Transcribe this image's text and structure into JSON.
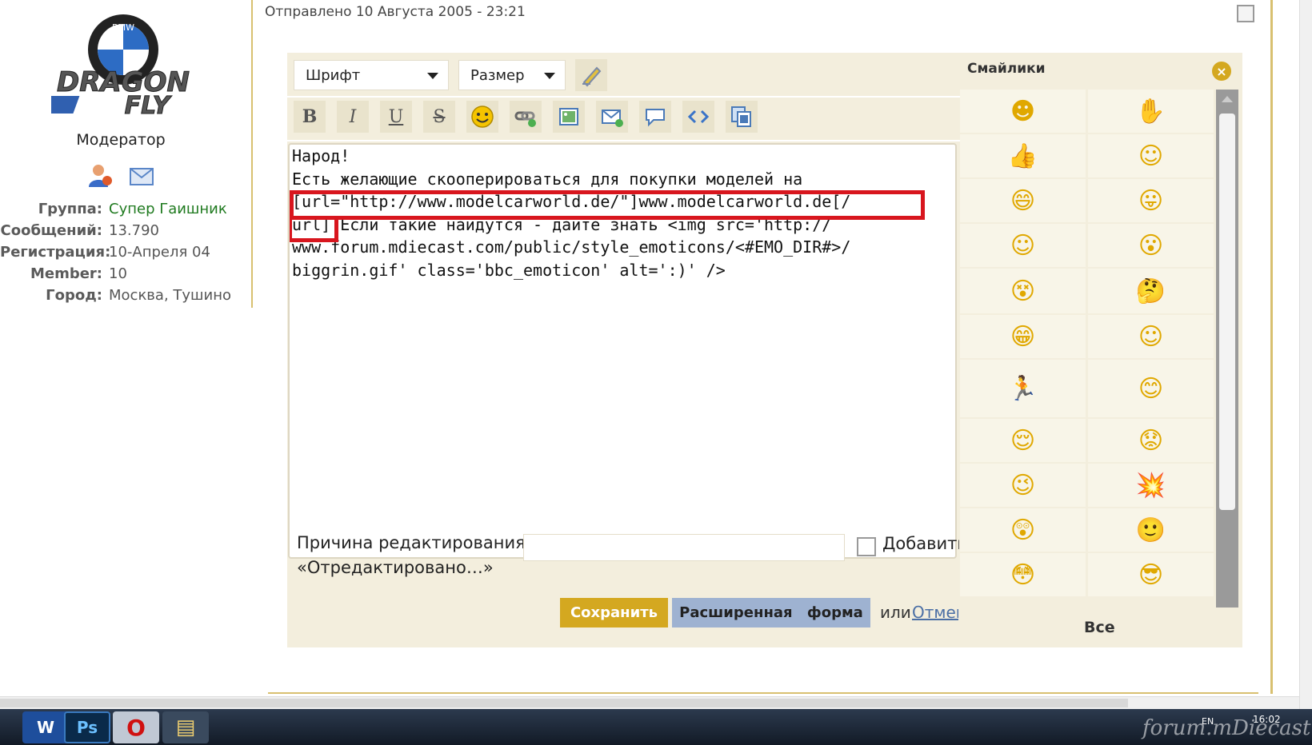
{
  "profile": {
    "logo_text_top": "DRAGON",
    "logo_text_bottom": "FLY",
    "logo_badge": "BMW",
    "role": "Модератор",
    "fields": [
      {
        "label": "Группа:",
        "value": "Супер Гаишник"
      },
      {
        "label": "Сообщений:",
        "value": "13.790"
      },
      {
        "label": "Регистрация:",
        "value": "10-Апреля 04"
      },
      {
        "label": "Member:",
        "value": "10"
      },
      {
        "label": "Город:",
        "value": "Москва, Тушино"
      }
    ],
    "group_color": "#1f7a1f"
  },
  "post": {
    "sent": "Отправлено 10 Августа 2005 - 23:21"
  },
  "editor": {
    "font_select": "Шрифт",
    "size_select": "Размер",
    "format_buttons": [
      "B",
      "I",
      "U",
      "S"
    ],
    "insert_icons": [
      "smiley-icon",
      "link-icon",
      "image-icon",
      "email-icon",
      "quote-icon",
      "code-icon",
      "paste-icon"
    ],
    "text_lines": [
      "Народ!",
      "Есть желающие скооперироваться для покупки моделей на",
      "[url=\"http://www.modelcarworld.de/\"]www.modelcarworld.de[/",
      "url] Если такие найдутся - дайте знать <img src='http://",
      "www.forum.mdiecast.com/public/style_emoticons/<#EMO_DIR#>/",
      "biggrin.gif' class='bbc_emoticon' alt=':)' />"
    ],
    "highlight_color": "#d8161e",
    "reason_label": "Причина редактирования «Отредактировано…»",
    "reason_value": "",
    "add_label": "Добавить",
    "save": "Сохранить",
    "advanced": "Расширенная форма",
    "or": "или",
    "cancel": "Отмена"
  },
  "emoticons": {
    "title": "Смайлики",
    "close": "×",
    "all": "Все",
    "cells": [
      "☻",
      "✋",
      "👍",
      "☺",
      "😄",
      "😛",
      "☺",
      "😮",
      "😵",
      "🤔",
      "😁",
      "☺",
      "🏃",
      "😊",
      "😌",
      "😟",
      "😉",
      "💥",
      "😲",
      "🙂",
      "😳",
      "😎"
    ]
  },
  "taskbar": {
    "apps": [
      {
        "name": "word",
        "label": "W"
      },
      {
        "name": "photoshop",
        "label": "Ps"
      },
      {
        "name": "opera",
        "label": "O"
      },
      {
        "name": "explorer",
        "label": "▤"
      }
    ],
    "lang": "EN",
    "clock": "16:02",
    "watermark": "forum.mDiecast.com"
  },
  "colors": {
    "accent_gold": "#d4a820",
    "panel_bg": "#f3eedd",
    "advanced_btn": "#9eb2d1"
  }
}
